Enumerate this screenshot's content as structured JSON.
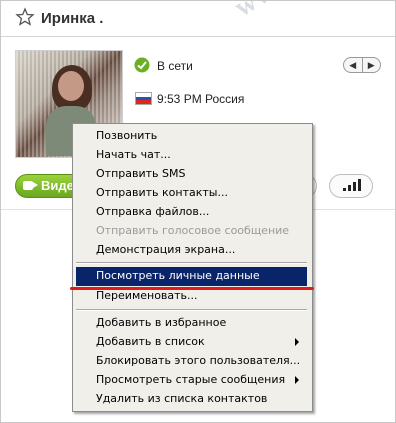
{
  "contact": {
    "name": "Иринка .",
    "status": "В сети",
    "local_time": "9:53 PM Россия"
  },
  "watermark": "www.softy.net",
  "call_bar": {
    "video_label": "Виде"
  },
  "context_menu": {
    "items": [
      {
        "label": "Позвонить"
      },
      {
        "label": "Начать чат..."
      },
      {
        "label": "Отправить SMS"
      },
      {
        "label": "Отправить контакты..."
      },
      {
        "label": "Отправка файлов..."
      },
      {
        "label": "Отправить голосовое сообщение"
      },
      {
        "label": "Демонстрация экрана..."
      },
      {
        "label": "Посмотреть личные данные"
      },
      {
        "label": "Переименовать..."
      },
      {
        "label": "Добавить в избранное"
      },
      {
        "label": "Добавить в список"
      },
      {
        "label": "Блокировать этого пользователя..."
      },
      {
        "label": "Просмотреть старые сообщения"
      },
      {
        "label": "Удалить из списка контактов"
      }
    ]
  },
  "colors": {
    "menu_highlight": "#0a246a",
    "annotation_underline": "#e01b1b",
    "video_button": "#7ab82a",
    "online_status": "#6ab023"
  }
}
